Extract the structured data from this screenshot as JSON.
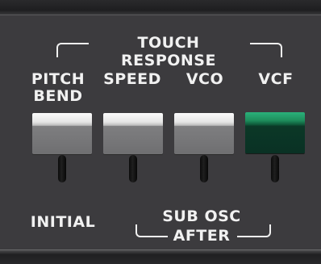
{
  "panel": {
    "group_title": "TOUCH RESPONSE",
    "columns": [
      {
        "label_line1": "PITCH",
        "label_line2": "BEND",
        "key_color": "white",
        "selected": false
      },
      {
        "label_line1": "SPEED",
        "label_line2": "",
        "key_color": "white",
        "selected": false
      },
      {
        "label_line1": "VCO",
        "label_line2": "",
        "key_color": "white",
        "selected": false
      },
      {
        "label_line1": "VCF",
        "label_line2": "",
        "key_color": "green",
        "selected": true
      }
    ],
    "bottom_left_label": "INITIAL",
    "bottom_right_label_line1": "SUB OSC",
    "bottom_right_label_line2": "AFTER"
  },
  "colors": {
    "panel": "#3c3b3e",
    "text": "#f1f1f1",
    "key_white": "#e4e4e4",
    "key_green": "#1e8e5c"
  }
}
